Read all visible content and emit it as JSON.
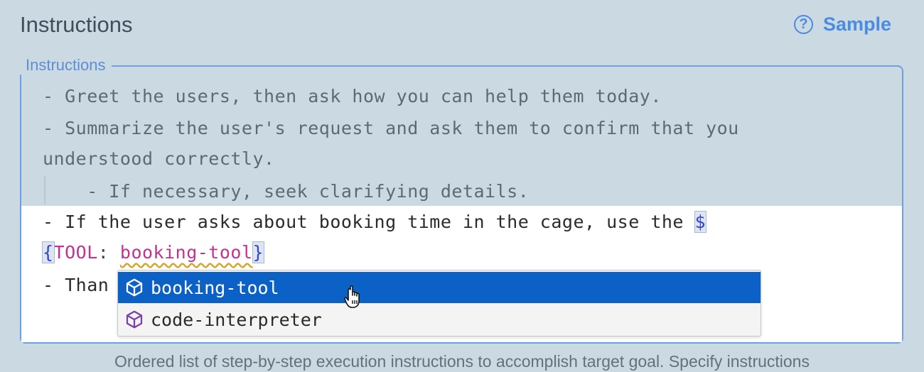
{
  "header": {
    "title": "Instructions",
    "sample_label": "Sample",
    "help_icon": "help-circle-icon"
  },
  "field": {
    "legend": "Instructions",
    "lines": [
      "- Greet the users, then ask how you can help them today.",
      "- Summarize the user's request and ask them to confirm that you",
      "understood correctly.",
      "    - If necessary, seek clarifying details.",
      "- If the user asks about booking time in the cage, use the ",
      "- Than"
    ],
    "token": {
      "dollar": "$",
      "open_brace": "{",
      "key": "TOOL",
      "colon": ": ",
      "value": "booking-tool",
      "close_brace": "}"
    }
  },
  "autocomplete": {
    "items": [
      {
        "label": "booking-tool",
        "icon": "cube-icon",
        "selected": true
      },
      {
        "label": "code-interpreter",
        "icon": "cube-icon",
        "selected": false
      }
    ]
  },
  "footer": {
    "hint": "Ordered list of step-by-step execution instructions to accomplish target goal. Specify instructions"
  },
  "colors": {
    "background": "#cbdae2",
    "accent": "#4a8ce0",
    "selection": "#0b61c6",
    "tool_token": "#c0338f"
  }
}
